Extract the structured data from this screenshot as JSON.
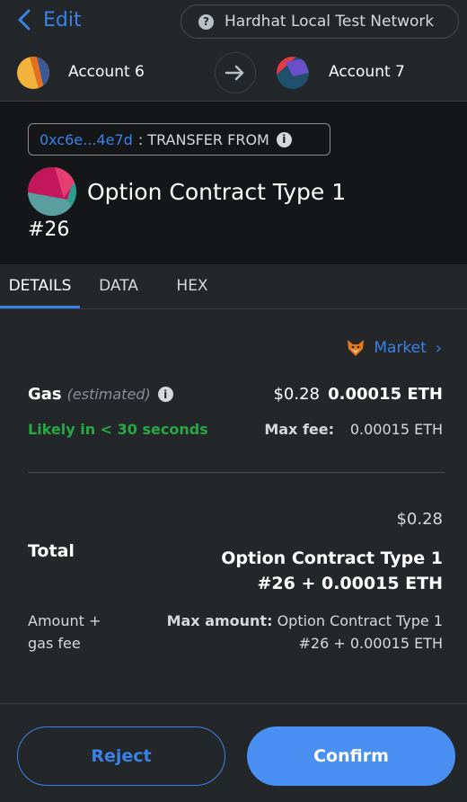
{
  "header": {
    "back_label": "Edit",
    "network_label": "Hardhat Local Test Network",
    "network_icon": "?"
  },
  "accounts": {
    "from": "Account 6",
    "to": "Account 7"
  },
  "summary": {
    "origin_address": "0xc6e...4e7d",
    "origin_action": ": TRANSFER FROM",
    "nft_name": "Option Contract Type 1",
    "nft_id": "#26"
  },
  "tabs": [
    {
      "label": "DETAILS",
      "active": true
    },
    {
      "label": "DATA",
      "active": false
    },
    {
      "label": "HEX",
      "active": false
    }
  ],
  "details": {
    "market_label": "Market",
    "gas_label": "Gas",
    "gas_estimated": "(estimated)",
    "gas_usd": "$0.28",
    "gas_eth": "0.00015 ETH",
    "likely_text": "Likely in < 30 seconds",
    "max_fee_label": "Max fee:",
    "max_fee_value": "0.00015 ETH",
    "total_usd": "$0.28",
    "total_label": "Total",
    "total_value": "Option Contract Type 1 #26 + 0.00015 ETH",
    "amount_gas_label": "Amount + gas fee",
    "max_amount_label": "Max amount:",
    "max_amount_value": "Option Contract Type 1 #26 + 0.00015 ETH"
  },
  "buttons": {
    "reject": "Reject",
    "confirm": "Confirm"
  },
  "colors": {
    "background": "#24272a",
    "summary_bg": "#141618",
    "accent": "#3b82e8",
    "success": "#28a745"
  }
}
